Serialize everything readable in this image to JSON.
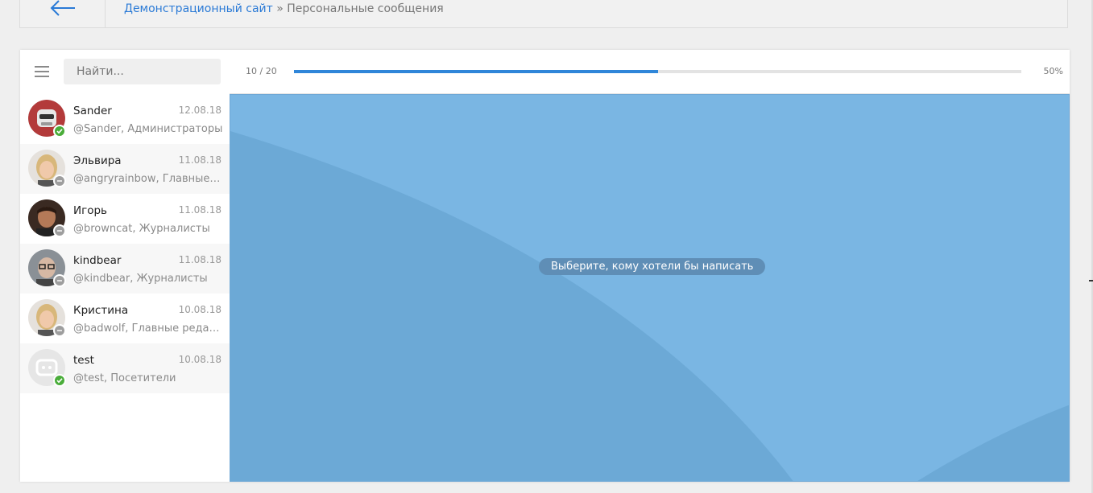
{
  "breadcrumb": {
    "site": "Демонстрационный сайт",
    "separator": "»",
    "page": "Персональные сообщения"
  },
  "search": {
    "placeholder": "Найти..."
  },
  "progress": {
    "count": "10 / 20",
    "percent_label": "50%",
    "value": 0.5
  },
  "hint": "Выберите, кому хотели бы написать",
  "conversations": [
    {
      "name": "Sander",
      "date": "12.08.18",
      "subtitle": "@Sander, Администраторы",
      "status": "online",
      "avatar": "robot-avatar"
    },
    {
      "name": "Эльвира",
      "date": "11.08.18",
      "subtitle": "@angryrainbow, Главные редакторы",
      "status": "away",
      "avatar": "woman-avatar"
    },
    {
      "name": "Игорь",
      "date": "11.08.18",
      "subtitle": "@browncat, Журналисты",
      "status": "away",
      "avatar": "man-avatar"
    },
    {
      "name": "kindbear",
      "date": "11.08.18",
      "subtitle": "@kindbear, Журналисты",
      "status": "away",
      "avatar": "man-glasses-avatar"
    },
    {
      "name": "Кристина",
      "date": "10.08.18",
      "subtitle": "@badwolf, Главные редакторы",
      "status": "away",
      "avatar": "woman-avatar"
    },
    {
      "name": "test",
      "date": "10.08.18",
      "subtitle": "@test, Посетители",
      "status": "online",
      "avatar": "default-bot-avatar"
    }
  ],
  "colors": {
    "accent": "#2f86d9",
    "chat_bg": "#7ab6e3",
    "online": "#4aad3a",
    "away": "#9e9e9e"
  }
}
